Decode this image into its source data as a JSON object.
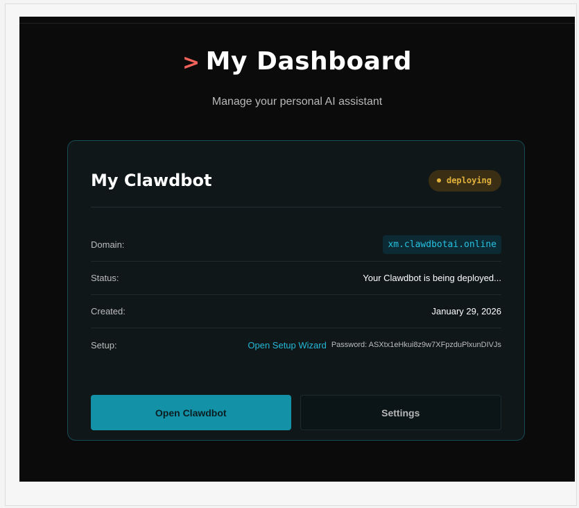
{
  "header": {
    "arrow": ">",
    "title": "My Dashboard",
    "subtitle": "Manage your personal AI assistant"
  },
  "card": {
    "title": "My Clawdbot",
    "badge": {
      "label": "deploying",
      "color": "#e1b13b"
    },
    "rows": [
      {
        "label": "Domain:",
        "value": "xm.clawdbotai.online"
      },
      {
        "label": "Status:",
        "value": "Your Clawdbot is being deployed..."
      },
      {
        "label": "Created:",
        "value": "January 29, 2026"
      },
      {
        "label": "Setup:",
        "link": "Open Setup Wizard",
        "password": "Password: ASXtx1eHkui8z9w7XFpzduPlxunDIVJs"
      }
    ],
    "buttons": {
      "primary": "Open Clawdbot",
      "secondary": "Settings"
    }
  },
  "colors": {
    "accent": "#1391a7",
    "link": "#25b9d8",
    "arrow": "#f0625a",
    "badge_bg": "#3a2f14"
  }
}
